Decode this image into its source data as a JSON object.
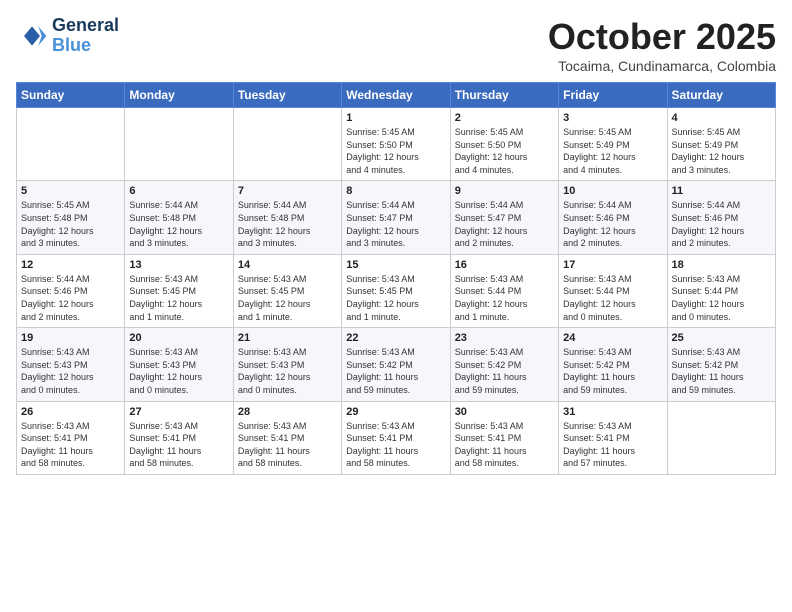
{
  "header": {
    "logo_line1": "General",
    "logo_line2": "Blue",
    "month_title": "October 2025",
    "location": "Tocaima, Cundinamarca, Colombia"
  },
  "weekdays": [
    "Sunday",
    "Monday",
    "Tuesday",
    "Wednesday",
    "Thursday",
    "Friday",
    "Saturday"
  ],
  "weeks": [
    [
      {
        "day": "",
        "text": ""
      },
      {
        "day": "",
        "text": ""
      },
      {
        "day": "",
        "text": ""
      },
      {
        "day": "1",
        "text": "Sunrise: 5:45 AM\nSunset: 5:50 PM\nDaylight: 12 hours\nand 4 minutes."
      },
      {
        "day": "2",
        "text": "Sunrise: 5:45 AM\nSunset: 5:50 PM\nDaylight: 12 hours\nand 4 minutes."
      },
      {
        "day": "3",
        "text": "Sunrise: 5:45 AM\nSunset: 5:49 PM\nDaylight: 12 hours\nand 4 minutes."
      },
      {
        "day": "4",
        "text": "Sunrise: 5:45 AM\nSunset: 5:49 PM\nDaylight: 12 hours\nand 3 minutes."
      }
    ],
    [
      {
        "day": "5",
        "text": "Sunrise: 5:45 AM\nSunset: 5:48 PM\nDaylight: 12 hours\nand 3 minutes."
      },
      {
        "day": "6",
        "text": "Sunrise: 5:44 AM\nSunset: 5:48 PM\nDaylight: 12 hours\nand 3 minutes."
      },
      {
        "day": "7",
        "text": "Sunrise: 5:44 AM\nSunset: 5:48 PM\nDaylight: 12 hours\nand 3 minutes."
      },
      {
        "day": "8",
        "text": "Sunrise: 5:44 AM\nSunset: 5:47 PM\nDaylight: 12 hours\nand 3 minutes."
      },
      {
        "day": "9",
        "text": "Sunrise: 5:44 AM\nSunset: 5:47 PM\nDaylight: 12 hours\nand 2 minutes."
      },
      {
        "day": "10",
        "text": "Sunrise: 5:44 AM\nSunset: 5:46 PM\nDaylight: 12 hours\nand 2 minutes."
      },
      {
        "day": "11",
        "text": "Sunrise: 5:44 AM\nSunset: 5:46 PM\nDaylight: 12 hours\nand 2 minutes."
      }
    ],
    [
      {
        "day": "12",
        "text": "Sunrise: 5:44 AM\nSunset: 5:46 PM\nDaylight: 12 hours\nand 2 minutes."
      },
      {
        "day": "13",
        "text": "Sunrise: 5:43 AM\nSunset: 5:45 PM\nDaylight: 12 hours\nand 1 minute."
      },
      {
        "day": "14",
        "text": "Sunrise: 5:43 AM\nSunset: 5:45 PM\nDaylight: 12 hours\nand 1 minute."
      },
      {
        "day": "15",
        "text": "Sunrise: 5:43 AM\nSunset: 5:45 PM\nDaylight: 12 hours\nand 1 minute."
      },
      {
        "day": "16",
        "text": "Sunrise: 5:43 AM\nSunset: 5:44 PM\nDaylight: 12 hours\nand 1 minute."
      },
      {
        "day": "17",
        "text": "Sunrise: 5:43 AM\nSunset: 5:44 PM\nDaylight: 12 hours\nand 0 minutes."
      },
      {
        "day": "18",
        "text": "Sunrise: 5:43 AM\nSunset: 5:44 PM\nDaylight: 12 hours\nand 0 minutes."
      }
    ],
    [
      {
        "day": "19",
        "text": "Sunrise: 5:43 AM\nSunset: 5:43 PM\nDaylight: 12 hours\nand 0 minutes."
      },
      {
        "day": "20",
        "text": "Sunrise: 5:43 AM\nSunset: 5:43 PM\nDaylight: 12 hours\nand 0 minutes."
      },
      {
        "day": "21",
        "text": "Sunrise: 5:43 AM\nSunset: 5:43 PM\nDaylight: 12 hours\nand 0 minutes."
      },
      {
        "day": "22",
        "text": "Sunrise: 5:43 AM\nSunset: 5:42 PM\nDaylight: 11 hours\nand 59 minutes."
      },
      {
        "day": "23",
        "text": "Sunrise: 5:43 AM\nSunset: 5:42 PM\nDaylight: 11 hours\nand 59 minutes."
      },
      {
        "day": "24",
        "text": "Sunrise: 5:43 AM\nSunset: 5:42 PM\nDaylight: 11 hours\nand 59 minutes."
      },
      {
        "day": "25",
        "text": "Sunrise: 5:43 AM\nSunset: 5:42 PM\nDaylight: 11 hours\nand 59 minutes."
      }
    ],
    [
      {
        "day": "26",
        "text": "Sunrise: 5:43 AM\nSunset: 5:41 PM\nDaylight: 11 hours\nand 58 minutes."
      },
      {
        "day": "27",
        "text": "Sunrise: 5:43 AM\nSunset: 5:41 PM\nDaylight: 11 hours\nand 58 minutes."
      },
      {
        "day": "28",
        "text": "Sunrise: 5:43 AM\nSunset: 5:41 PM\nDaylight: 11 hours\nand 58 minutes."
      },
      {
        "day": "29",
        "text": "Sunrise: 5:43 AM\nSunset: 5:41 PM\nDaylight: 11 hours\nand 58 minutes."
      },
      {
        "day": "30",
        "text": "Sunrise: 5:43 AM\nSunset: 5:41 PM\nDaylight: 11 hours\nand 58 minutes."
      },
      {
        "day": "31",
        "text": "Sunrise: 5:43 AM\nSunset: 5:41 PM\nDaylight: 11 hours\nand 57 minutes."
      },
      {
        "day": "",
        "text": ""
      }
    ]
  ]
}
